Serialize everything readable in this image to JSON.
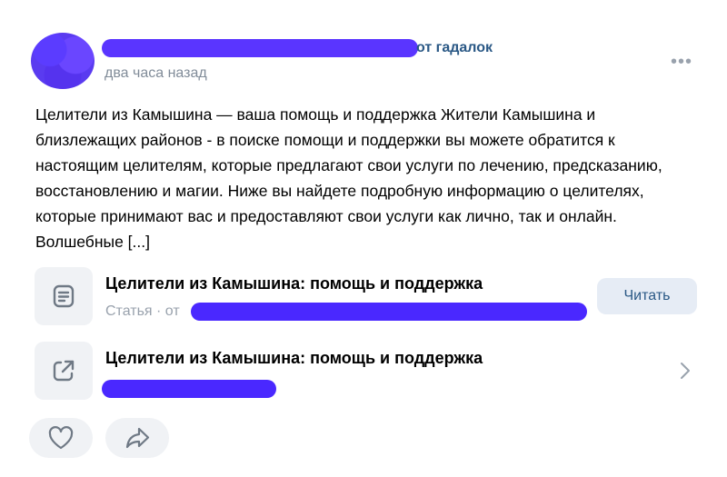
{
  "post": {
    "author_suffix": "от гадалок",
    "time": "два часа назад",
    "more_label": "•••",
    "text": "Целители из Камышина — ваша помощь и поддержка Жители Камышина и близлежащих районов - в поиске помощи и поддержки вы можете обратится к настоящим целителям, которые предлагают свои услуги по лечению, предсказанию, восстановлению и магии. Ниже вы найдете подробную информацию о целителях, которые принимают вас и предоставляют свои услуги как лично, так и онлайн. Волшебные [...]"
  },
  "article": {
    "title": "Целители из Камышина: помощь и поддержка",
    "meta": "Статья · от",
    "read_label": "Читать",
    "icon": "article-icon"
  },
  "link": {
    "title": "Целители из Камышина: помощь и поддержка",
    "icon": "external-link-icon"
  },
  "actions": {
    "like_icon": "heart-icon",
    "share_icon": "share-icon"
  },
  "colors": {
    "link": "#2a5885",
    "muted": "#818c99",
    "button_bg": "#f0f2f5",
    "redaction": "#5a35ff"
  }
}
